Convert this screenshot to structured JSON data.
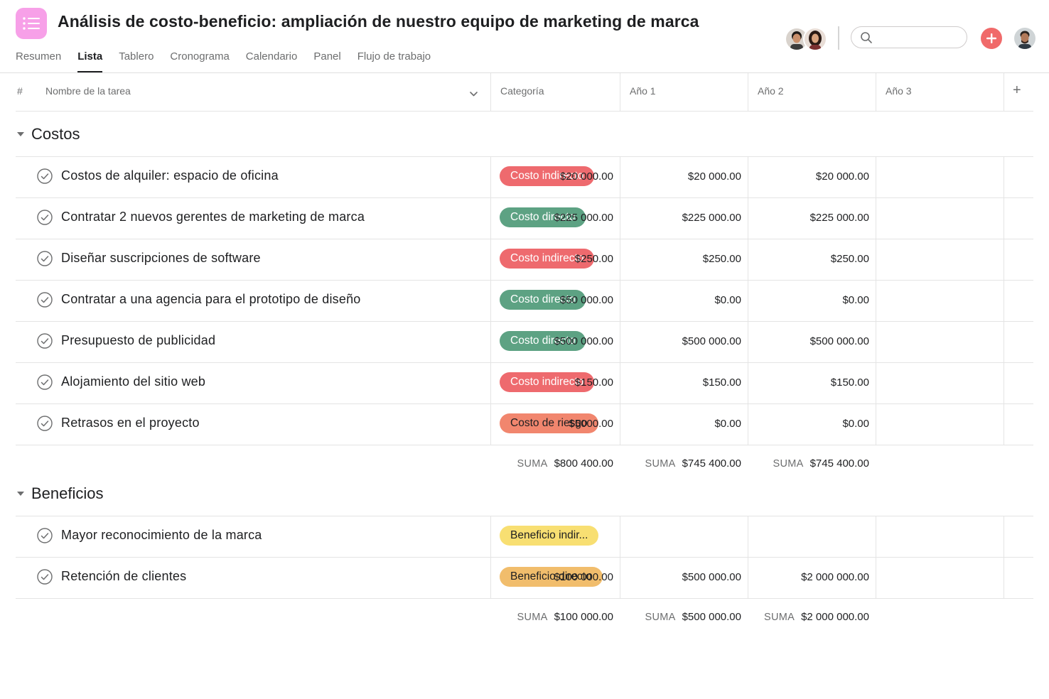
{
  "project": {
    "title": "Análisis de costo-beneficio: ampliación de nuestro equipo de marketing de marca"
  },
  "tabs": [
    {
      "label": "Resumen",
      "active": false
    },
    {
      "label": "Lista",
      "active": true
    },
    {
      "label": "Tablero",
      "active": false
    },
    {
      "label": "Cronograma",
      "active": false
    },
    {
      "label": "Calendario",
      "active": false
    },
    {
      "label": "Panel",
      "active": false
    },
    {
      "label": "Flujo de trabajo",
      "active": false
    }
  ],
  "search": {
    "value": "",
    "placeholder": ""
  },
  "table": {
    "columns": {
      "index": "#",
      "task_name": "Nombre de la tarea",
      "category": "Categoría",
      "year1": "Año 1",
      "year2": "Año 2",
      "year3": "Año 3",
      "add_column": "+"
    },
    "sum_label": "SUMA"
  },
  "sections": [
    {
      "name": "Costos",
      "tasks": [
        {
          "name": "Costos de alquiler: espacio de oficina",
          "category": "Costo indirecto",
          "category_type": "indirect-cost",
          "year1": "$20 000.00",
          "year2": "$20 000.00",
          "year3": "$20 000.00"
        },
        {
          "name": "Contratar 2 nuevos gerentes de marketing de marca",
          "category": "Costo directo",
          "category_type": "direct-cost",
          "year1": "$225 000.00",
          "year2": "$225 000.00",
          "year3": "$225 000.00"
        },
        {
          "name": "Diseñar suscripciones de software",
          "category": "Costo indirecto",
          "category_type": "indirect-cost",
          "year1": "$250.00",
          "year2": "$250.00",
          "year3": "$250.00"
        },
        {
          "name": "Contratar a una agencia para el prototipo de diseño",
          "category": "Costo directo",
          "category_type": "direct-cost",
          "year1": "$50 000.00",
          "year2": "$0.00",
          "year3": "$0.00"
        },
        {
          "name": "Presupuesto de publicidad",
          "category": "Costo directo",
          "category_type": "direct-cost",
          "year1": "$500 000.00",
          "year2": "$500 000.00",
          "year3": "$500 000.00"
        },
        {
          "name": "Alojamiento del sitio web",
          "category": "Costo indirecto",
          "category_type": "indirect-cost",
          "year1": "$150.00",
          "year2": "$150.00",
          "year3": "$150.00"
        },
        {
          "name": "Retrasos en el proyecto",
          "category": "Costo de riesgo",
          "category_type": "risk-cost",
          "year1": "$5000.00",
          "year2": "$0.00",
          "year3": "$0.00"
        }
      ],
      "sums": {
        "year1": "$800 400.00",
        "year2": "$745 400.00",
        "year3": "$745 400.00"
      }
    },
    {
      "name": "Beneficios",
      "tasks": [
        {
          "name": "Mayor reconocimiento de la marca",
          "category": "Beneficio indir...",
          "category_type": "indirect-benefit",
          "year1": "",
          "year2": "",
          "year3": ""
        },
        {
          "name": "Retención de clientes",
          "category": "Beneficio directo",
          "category_type": "direct-benefit",
          "year1": "$100 000.00",
          "year2": "$500 000.00",
          "year3": "$2 000 000.00"
        }
      ],
      "sums": {
        "year1": "$100 000.00",
        "year2": "$500 000.00",
        "year3": "$2 000 000.00"
      }
    }
  ],
  "category_colors": {
    "indirect-cost": {
      "bg": "#ee6a6e",
      "fg": "#ffffff"
    },
    "direct-cost": {
      "bg": "#5da283",
      "fg": "#ffffff"
    },
    "risk-cost": {
      "bg": "#f1866e",
      "fg": "#1e1f21"
    },
    "indirect-benefit": {
      "bg": "#f8df72",
      "fg": "#1e1f21"
    },
    "direct-benefit": {
      "bg": "#f1bd6c",
      "fg": "#1e1f21"
    }
  },
  "colors": {
    "accent": "#f06a6a",
    "app_icon": "#f7a0e8"
  },
  "icons": {
    "app": "list-icon",
    "search": "search-icon",
    "add": "plus-icon",
    "task_complete": "check-circle-icon",
    "section_toggle": "triangle-down-icon",
    "sort": "chevron-down-icon"
  }
}
